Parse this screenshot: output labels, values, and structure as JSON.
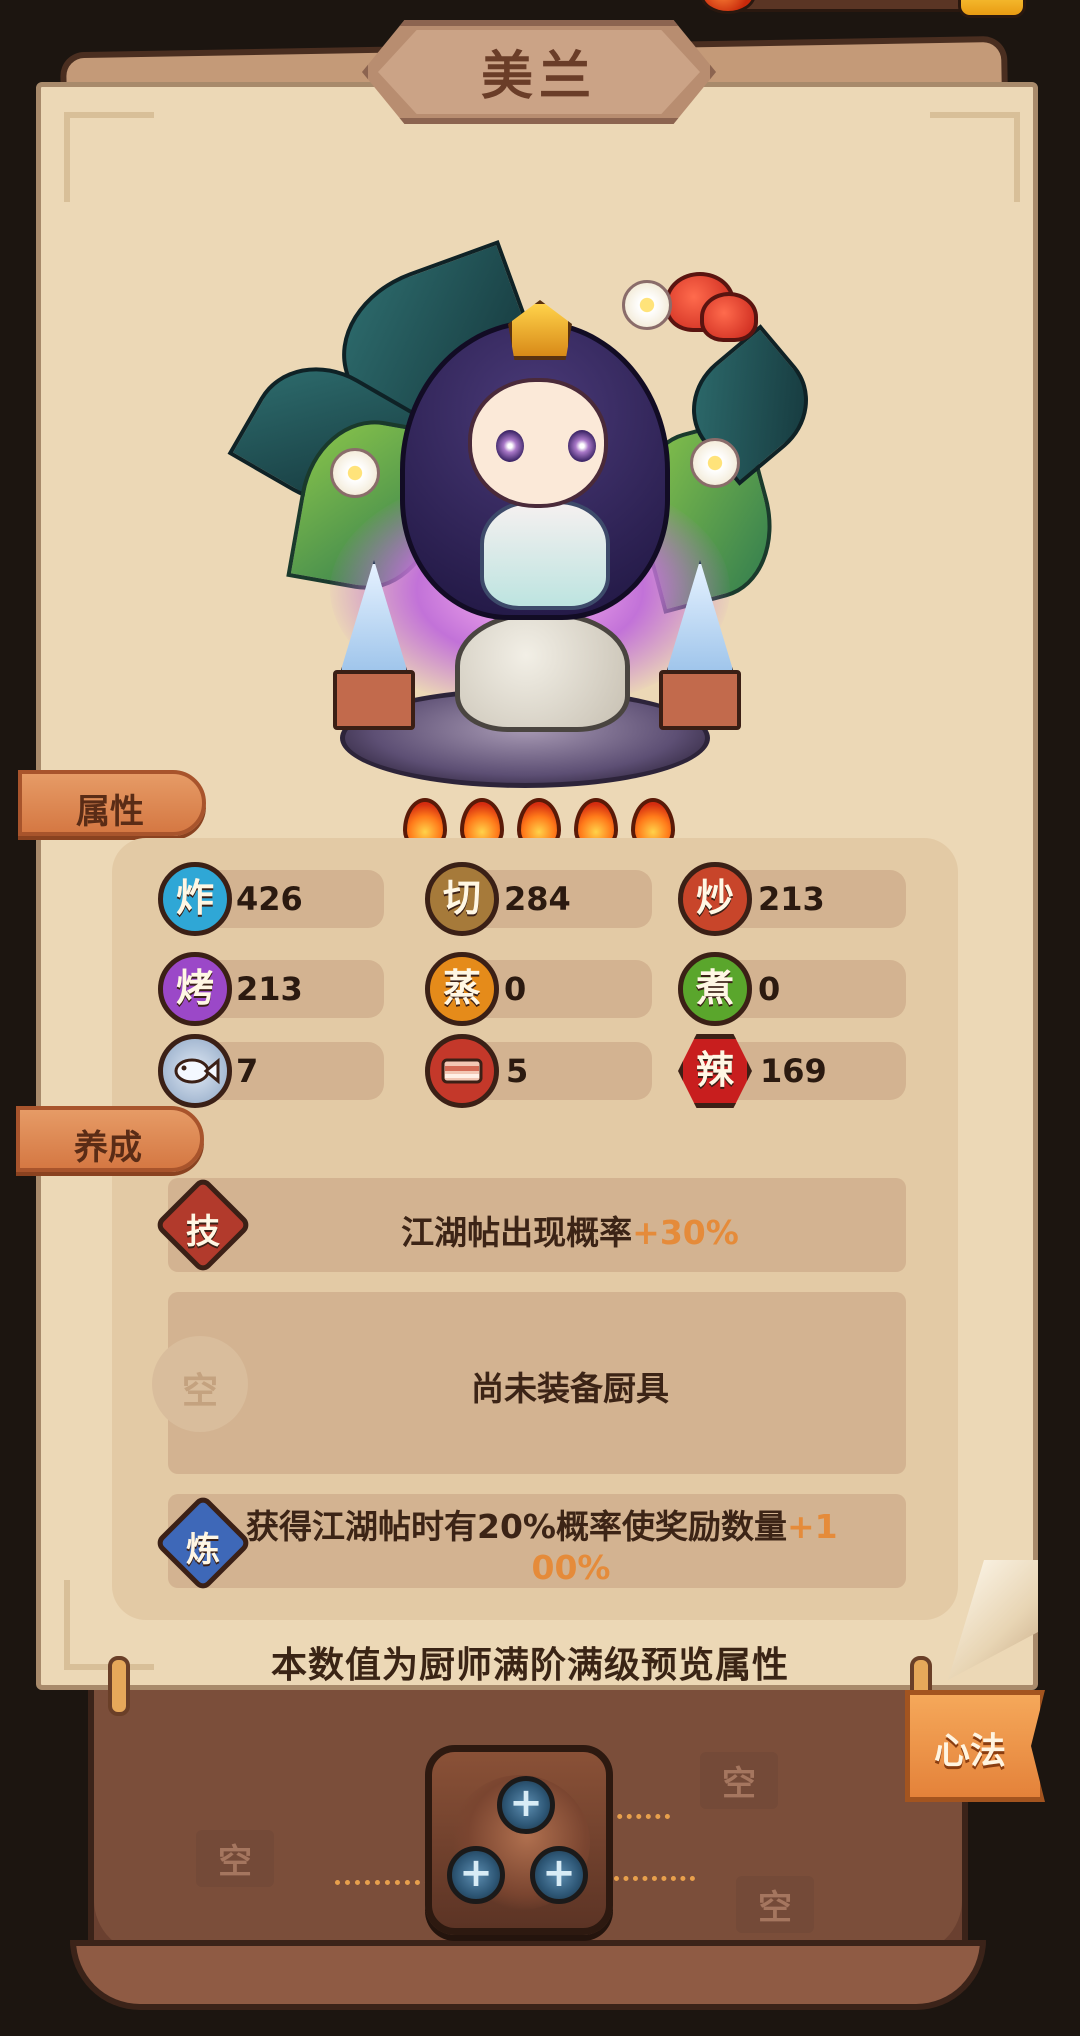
{
  "chef_name": "美兰",
  "tabs": {
    "attributes": "属性",
    "cultivation": "养成"
  },
  "rarity_flames": 5,
  "stats": [
    {
      "icon": "炸",
      "name": "fry",
      "value": "426",
      "color": "#2fa7d6"
    },
    {
      "icon": "切",
      "name": "cut",
      "value": "284",
      "color": "#a67a3a"
    },
    {
      "icon": "炒",
      "name": "stir-fry",
      "value": "213",
      "color": "#c8452a"
    },
    {
      "icon": "烤",
      "name": "roast",
      "value": "213",
      "color": "#9b48c8"
    },
    {
      "icon": "蒸",
      "name": "steam",
      "value": "0",
      "color": "#e58b1a"
    },
    {
      "icon": "煮",
      "name": "boil",
      "value": "0",
      "color": "#5aa62c"
    },
    {
      "icon": "fish-icon",
      "name": "fish",
      "value": "7",
      "color": "#8ea6c4"
    },
    {
      "icon": "meat-icon",
      "name": "meat",
      "value": "5",
      "color": "#c4382a"
    },
    {
      "icon": "辣",
      "name": "spicy",
      "value": "169",
      "color": "#c81e1e"
    }
  ],
  "skill": {
    "badge": "技",
    "text": "江湖帖出现概率",
    "bonus": "+30%"
  },
  "equipment": {
    "badge": "空",
    "text": "尚未装备厨具"
  },
  "refine": {
    "badge": "炼",
    "text_line1": "获得江湖帖时有20%概率使奖励数量",
    "bonus_line1": "+1",
    "bonus_line2": "00%"
  },
  "footnote": "本数值为厨师满阶满级预览属性",
  "heart_method": {
    "tag": "心法",
    "slots": [
      "空",
      "空",
      "空"
    ],
    "plus": "+"
  }
}
